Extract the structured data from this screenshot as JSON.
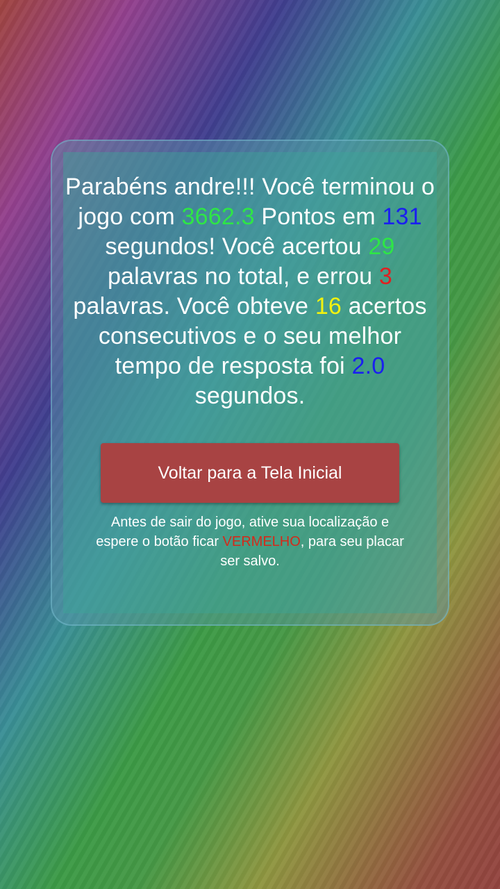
{
  "colors": {
    "points": "#2ee646",
    "seconds": "#1a1ff0",
    "correct": "#2ee646",
    "errors": "#e02020",
    "streak": "#f2f20f",
    "best_time": "#1a1ff0",
    "button": "#a84343",
    "warning_word": "#d42a1a"
  },
  "result": {
    "t1": "Parabéns andre!!! Você terminou o jogo com ",
    "points": "3662.3",
    "t2": " Pontos em ",
    "seconds": "131",
    "t3": " segundos! Você acertou ",
    "correct": "29",
    "t4": " palavras no total, e errou ",
    "errors": "3",
    "t5": " palavras. Você obteve ",
    "streak": "16",
    "t6": " acertos consecutivos e o seu melhor tempo de resposta foi ",
    "best_time": "2.0",
    "t7": " segundos."
  },
  "button": {
    "home_label": "Voltar para a Tela Inicial"
  },
  "note": {
    "part1": "Antes de sair do jogo, ative sua localização e espere o botão ficar ",
    "highlight": "VERMELHO",
    "part2": ", para seu placar ser salvo."
  }
}
